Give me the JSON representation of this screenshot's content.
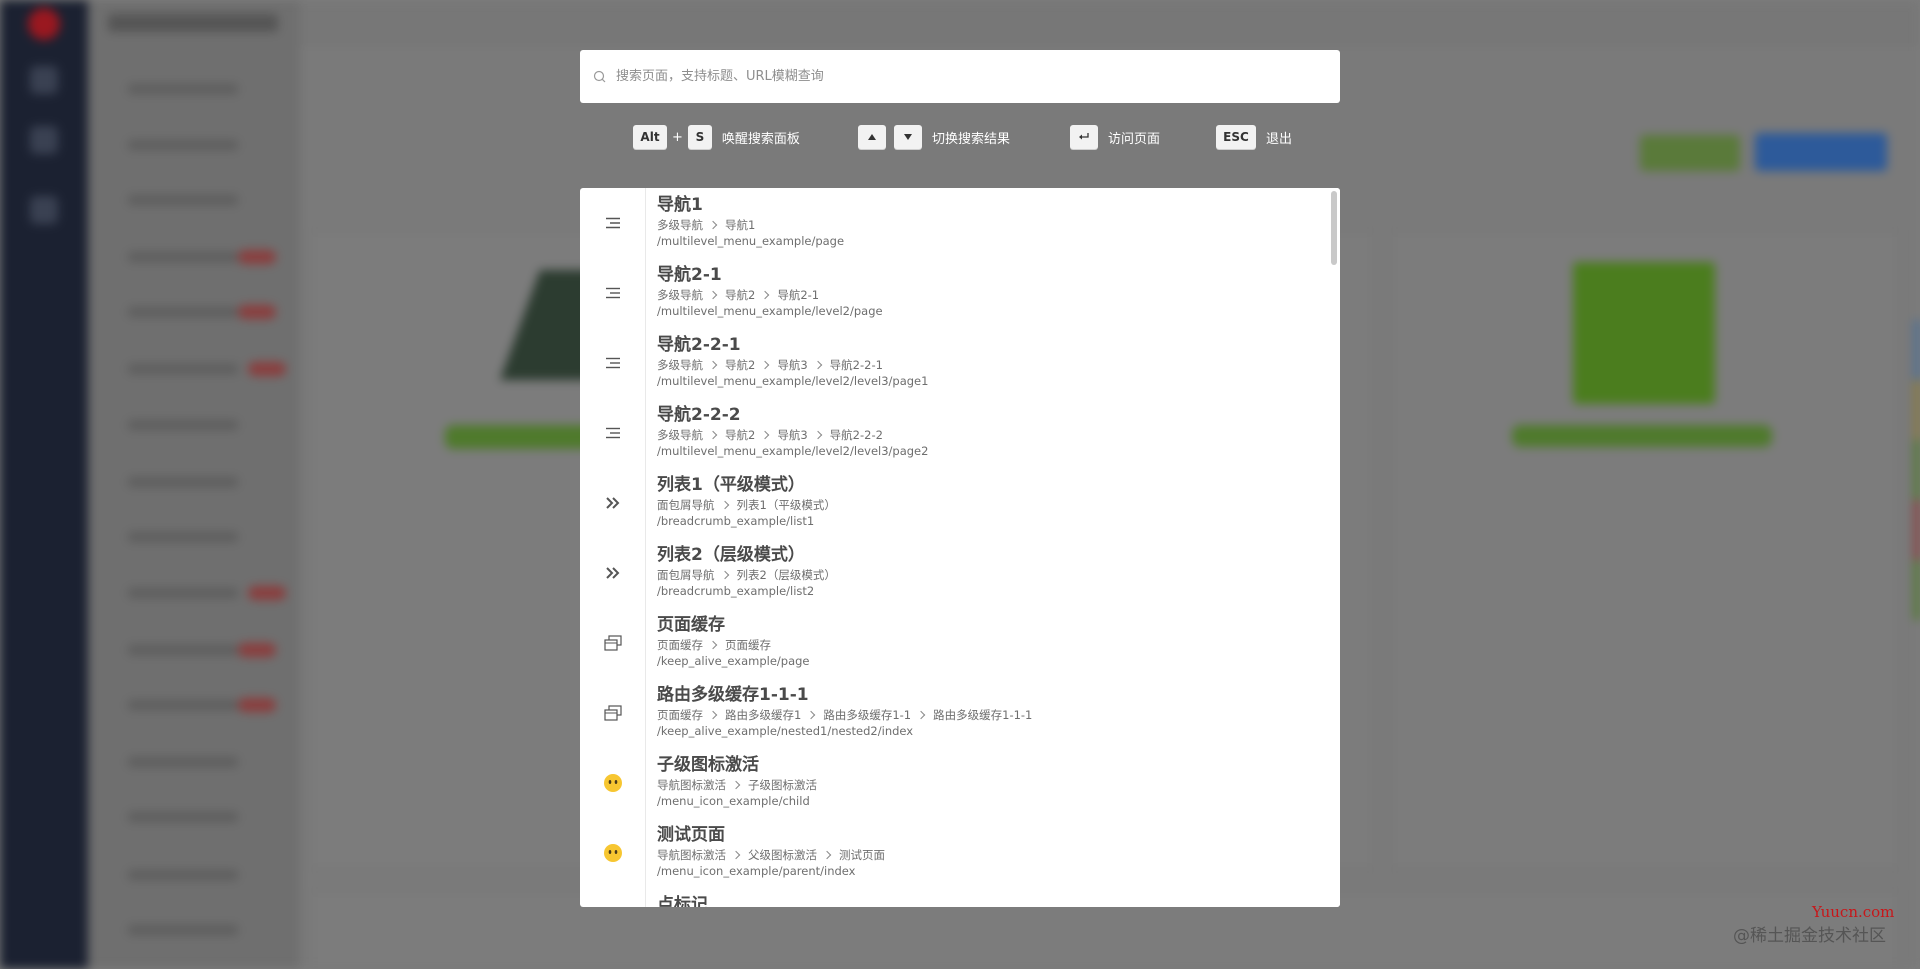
{
  "search": {
    "placeholder": "搜索页面，支持标题、URL模糊查询",
    "value": ""
  },
  "hints": [
    {
      "keys": [
        "Alt",
        "S"
      ],
      "joiner": "+",
      "label": "唤醒搜索面板"
    },
    {
      "keys": [
        "arrow-up-icon",
        "arrow-down-icon"
      ],
      "label": "切换搜索结果"
    },
    {
      "keys": [
        "enter-icon"
      ],
      "label": "访问页面"
    },
    {
      "keys": [
        "ESC"
      ],
      "label": "退出"
    }
  ],
  "results": [
    {
      "icon": "menu-lines-icon",
      "title": "导航1",
      "breadcrumb": [
        "多级导航",
        "导航1"
      ],
      "path": "/multilevel_menu_example/page"
    },
    {
      "icon": "menu-lines-icon",
      "title": "导航2-1",
      "breadcrumb": [
        "多级导航",
        "导航2",
        "导航2-1"
      ],
      "path": "/multilevel_menu_example/level2/page"
    },
    {
      "icon": "menu-lines-icon",
      "title": "导航2-2-1",
      "breadcrumb": [
        "多级导航",
        "导航2",
        "导航3",
        "导航2-2-1"
      ],
      "path": "/multilevel_menu_example/level2/level3/page1"
    },
    {
      "icon": "menu-lines-icon",
      "title": "导航2-2-2",
      "breadcrumb": [
        "多级导航",
        "导航2",
        "导航3",
        "导航2-2-2"
      ],
      "path": "/multilevel_menu_example/level2/level3/page2"
    },
    {
      "icon": "double-chevron-right-icon",
      "title": "列表1（平级模式）",
      "breadcrumb": [
        "面包屑导航",
        "列表1（平级模式）"
      ],
      "path": "/breadcrumb_example/list1"
    },
    {
      "icon": "double-chevron-right-icon",
      "title": "列表2（层级模式）",
      "breadcrumb": [
        "面包屑导航",
        "列表2（层级模式）"
      ],
      "path": "/breadcrumb_example/list2"
    },
    {
      "icon": "window-stack-icon",
      "title": "页面缓存",
      "breadcrumb": [
        "页面缓存",
        "页面缓存"
      ],
      "path": "/keep_alive_example/page"
    },
    {
      "icon": "window-stack-icon",
      "title": "路由多级缓存1-1-1",
      "breadcrumb": [
        "页面缓存",
        "路由多级缓存1",
        "路由多级缓存1-1",
        "路由多级缓存1-1-1"
      ],
      "path": "/keep_alive_example/nested1/nested2/index"
    },
    {
      "icon": "emoji-face-icon",
      "title": "子级图标激活",
      "breadcrumb": [
        "导航图标激活",
        "子级图标激活"
      ],
      "path": "/menu_icon_example/child"
    },
    {
      "icon": "emoji-face-icon",
      "title": "测试页面",
      "breadcrumb": [
        "导航图标激活",
        "父级图标激活",
        "测试页面"
      ],
      "path": "/menu_icon_example/parent/index"
    },
    {
      "icon": "emoji-face-icon",
      "title": "点标记",
      "breadcrumb": [],
      "path": ""
    }
  ],
  "watermark": {
    "site": "Yuucn.com",
    "credit": "@稀土掘金技术社区"
  },
  "colors": {
    "overlay": "#7d7d7d",
    "panel": "#ffffff",
    "title_text": "#4a4a4a",
    "meta_text": "#6e6e6e",
    "emoji_yellow": "#f7c631",
    "watermark_red": "#c7171a"
  }
}
